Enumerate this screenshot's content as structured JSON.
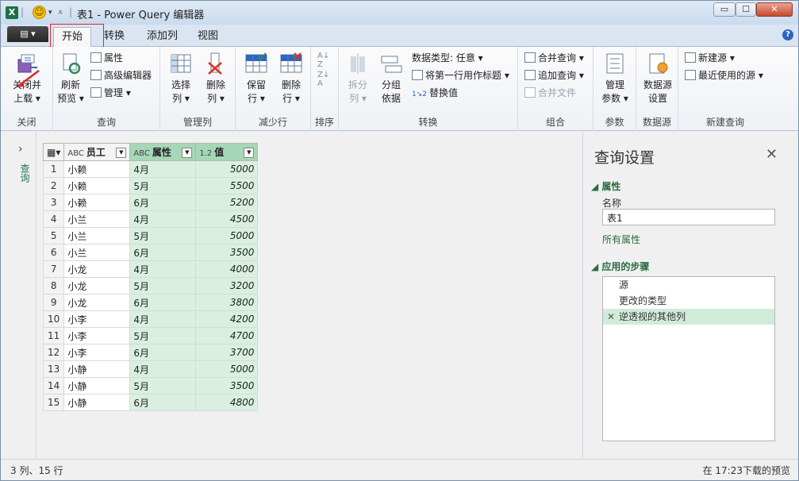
{
  "title": "表1 - Power Query 编辑器",
  "window": {
    "minimize": "▭",
    "maximize": "☐",
    "close": "✕"
  },
  "tabs": [
    "开始",
    "转换",
    "添加列",
    "视图"
  ],
  "file_button": "▤ ▾",
  "help": "?",
  "ribbon": {
    "close_group": {
      "label": "关闭",
      "btn_line1": "关闭并",
      "btn_line2": "上载 ▾"
    },
    "query_group": {
      "label": "查询",
      "refresh1": "刷新",
      "refresh2": "预览 ▾",
      "properties": "属性",
      "advanced": "高级编辑器",
      "manage": "管理 ▾"
    },
    "cols_group": {
      "label": "管理列",
      "choose1": "选择",
      "choose2": "列 ▾",
      "remove1": "删除",
      "remove2": "列 ▾"
    },
    "rows_group": {
      "label": "减少行",
      "keep1": "保留",
      "keep2": "行 ▾",
      "del1": "删除",
      "del2": "行 ▾"
    },
    "sort_group": {
      "label": "排序"
    },
    "transform_group": {
      "label": "转换",
      "split1": "拆分",
      "split2": "列 ▾",
      "group1": "分组",
      "group2": "依据",
      "datatype": "数据类型: 任意 ▾",
      "first_row": "将第一行用作标题 ▾",
      "replace": "替换值"
    },
    "combine_group": {
      "label": "组合",
      "merge": "合并查询 ▾",
      "append": "追加查询 ▾",
      "merge_files": "合并文件"
    },
    "params_group": {
      "label": "参数",
      "manage1": "管理",
      "manage2": "参数 ▾"
    },
    "source_group": {
      "label": "数据源",
      "settings1": "数据源",
      "settings2": "设置"
    },
    "newquery_group": {
      "label": "新建查询",
      "new_source": "新建源 ▾",
      "recent": "最近使用的源 ▾"
    }
  },
  "nav": {
    "label": "查询"
  },
  "table": {
    "columns": [
      {
        "type": "ABC",
        "name": "员工"
      },
      {
        "type": "ABC",
        "name": "属性"
      },
      {
        "type": "1.2",
        "name": "值"
      }
    ],
    "rows": [
      [
        "1",
        "小赖",
        "4月",
        "5000"
      ],
      [
        "2",
        "小赖",
        "5月",
        "5500"
      ],
      [
        "3",
        "小赖",
        "6月",
        "5200"
      ],
      [
        "4",
        "小兰",
        "4月",
        "4500"
      ],
      [
        "5",
        "小兰",
        "5月",
        "5000"
      ],
      [
        "6",
        "小兰",
        "6月",
        "3500"
      ],
      [
        "7",
        "小龙",
        "4月",
        "4000"
      ],
      [
        "8",
        "小龙",
        "5月",
        "3200"
      ],
      [
        "9",
        "小龙",
        "6月",
        "3800"
      ],
      [
        "10",
        "小李",
        "4月",
        "4200"
      ],
      [
        "11",
        "小李",
        "5月",
        "4700"
      ],
      [
        "12",
        "小李",
        "6月",
        "3700"
      ],
      [
        "13",
        "小静",
        "4月",
        "5000"
      ],
      [
        "14",
        "小静",
        "5月",
        "3500"
      ],
      [
        "15",
        "小静",
        "6月",
        "4800"
      ]
    ]
  },
  "settings": {
    "title": "查询设置",
    "close": "✕",
    "props_head": "◢ 属性",
    "name_label": "名称",
    "name_value": "表1",
    "all_props": "所有属性",
    "steps_head": "◢ 应用的步骤",
    "steps": [
      "源",
      "更改的类型",
      "逆透视的其他列"
    ]
  },
  "status": {
    "left": "3 列、15 行",
    "right": "在 17:23下载的预览"
  }
}
